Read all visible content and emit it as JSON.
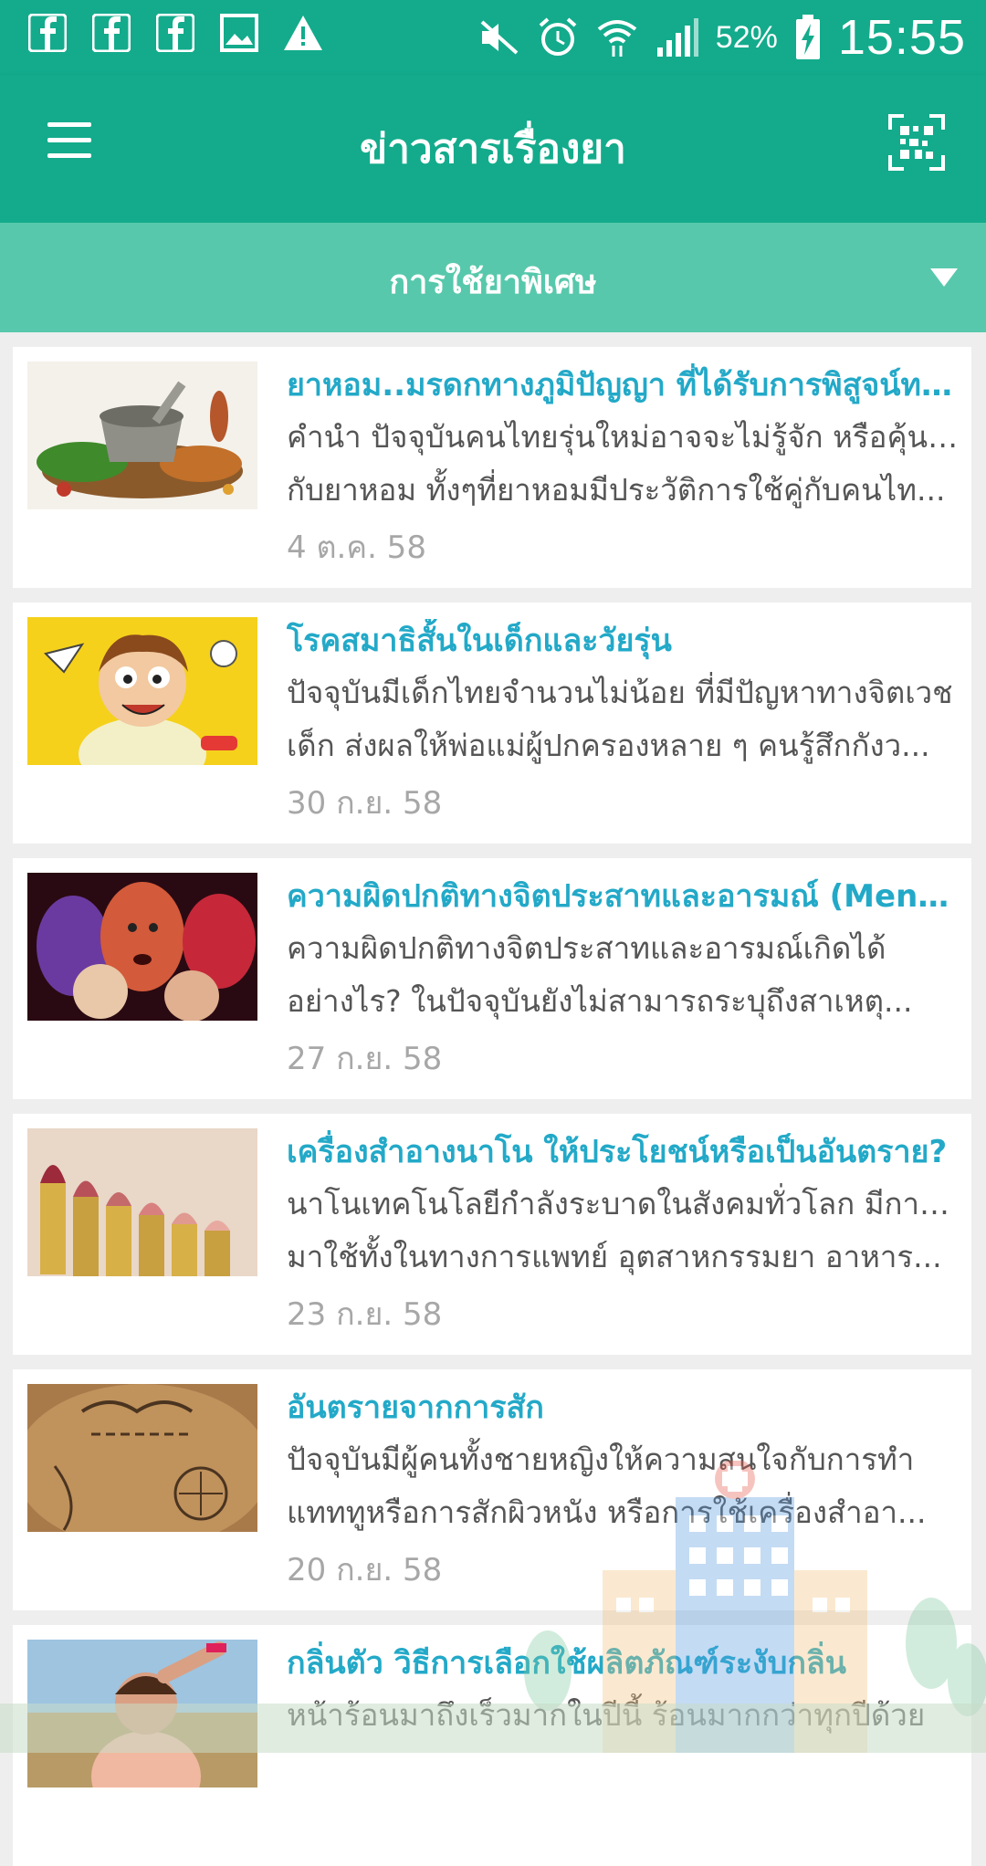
{
  "status_bar": {
    "battery_pct": "52%",
    "time": "15:55",
    "left_icons": [
      "facebook-icon",
      "facebook-icon",
      "facebook-icon",
      "image-icon",
      "warning-icon"
    ],
    "right_icons": [
      "mute-icon",
      "alarm-icon",
      "wifi-icon",
      "signal-icon",
      "battery-charging-icon"
    ]
  },
  "app_bar": {
    "title": "ข่าวสารเรื่องยา",
    "menu_icon": "hamburger-menu-icon",
    "action_icon": "qr-code-scan-icon"
  },
  "filter": {
    "selected": "การใช้ยาพิเศษ",
    "icon": "dropdown-triangle-icon"
  },
  "articles": [
    {
      "title": "ยาหอม..มรดกทางภูมิปัญญา ที่ได้รับการพิสูจน์ทา...",
      "excerpt_line1": "คำนำ ปัจจุบันคนไทยรุ่นใหม่อาจจะไม่รู้จัก หรือคุ้นเคย",
      "excerpt_line2": "กับยาหอม ทั้งๆที่ยาหอมมีประวัติการใช้คู่กับคนไท...",
      "date": "4 ต.ค. 58",
      "image": "herbal-mortar-image"
    },
    {
      "title": "โรคสมาธิสั้นในเด็กและวัยรุ่น",
      "excerpt_line1": "ปัจจุบันมีเด็กไทยจำนวนไม่น้อย ที่มีปัญหาทางจิตเวช",
      "excerpt_line2": "เด็ก ส่งผลให้พ่อแม่ผู้ปกครองหลาย ๆ คนรู้สึกกังว...",
      "date": "30 ก.ย. 58",
      "image": "cartoon-boy-image"
    },
    {
      "title": "ความผิดปกติทางจิตประสาทและอารมณ์ (Mental...",
      "excerpt_line1": "ความผิดปกติทางจิตประสาทและอารมณ์เกิดได้",
      "excerpt_line2": "อย่างไร? ในปัจจุบันยังไม่สามารถระบุถึงสาเหตุ...",
      "date": "27 ก.ย. 58",
      "image": "distressed-faces-image"
    },
    {
      "title": "เครื่องสำอางนาโน ให้ประโยชน์หรือเป็นอันตราย?",
      "excerpt_line1": "นาโนเทคโนโลยีกำลังระบาดในสังคมทั่วโลก มีการนำ",
      "excerpt_line2": "มาใช้ทั้งในทางการแพทย์ อุตสาหกรรมยา อาหาร...",
      "date": "23 ก.ย. 58",
      "image": "lipsticks-image"
    },
    {
      "title": "อันตรายจากการสัก",
      "excerpt_line1": "ปัจจุบันมีผู้คนทั้งชายหญิงให้ความสนใจกับการทำ",
      "excerpt_line2": "แทททูหรือการสักผิวหนัง หรือการใช้เครื่องสำอา...",
      "date": "20 ก.ย. 58",
      "image": "tattoo-image"
    },
    {
      "title": "กลิ่นตัว วิธีการเลือกใช้ผลิตภัณฑ์ระงับกลิ่น",
      "excerpt_line1": "หน้าร้อนมาถึงเร็วมากในปีนี้ ร้อนมากกว่าทุกปีด้วย",
      "excerpt_line2": "",
      "date": "",
      "image": "sweating-woman-image"
    }
  ]
}
